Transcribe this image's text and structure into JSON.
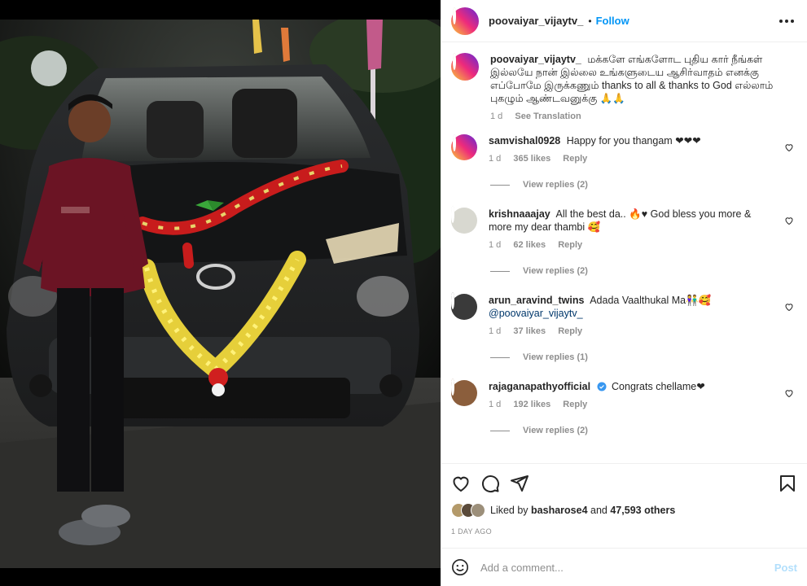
{
  "post": {
    "username": "poovaiyar_vijaytv_",
    "separator": "•",
    "follow_label": "Follow",
    "more_icon": "more-options-icon"
  },
  "caption": {
    "username": "poovaiyar_vijaytv_",
    "text": "மக்களே எங்களோட புதிய கார் நீங்கள் இல்லயே நான் இல்லை உங்களுடைய ஆசிர்வாதம் எனக்கு எப்போமே இருக்கணும் thanks to all & thanks to God எல்லாம் புகழும் ஆண்டவனுக்கு 🙏🙏",
    "time": "1 d",
    "translation_label": "See Translation"
  },
  "comments": [
    {
      "username": "samvishal0928",
      "text": "Happy for you thangam ❤❤❤",
      "time": "1 d",
      "likes": "365 likes",
      "reply_label": "Reply",
      "view_replies": "View replies (2)",
      "avatar_color": "#c9a9d6"
    },
    {
      "username": "krishnaaajay",
      "text": "All the best da.. 🔥♥ God bless you more & more my dear thambi 🥰",
      "time": "1 d",
      "likes": "62 likes",
      "reply_label": "Reply",
      "view_replies": "View replies (2)",
      "avatar_color": "#d8d8d0"
    },
    {
      "username": "arun_aravind_twins",
      "text": "Adada Vaalthukal Ma👫🥰",
      "mention": "@poovaiyar_vijaytv_",
      "time": "1 d",
      "likes": "37 likes",
      "reply_label": "Reply",
      "view_replies": "View replies (1)",
      "avatar_color": "#3a3a3a"
    },
    {
      "username": "rajaganapathyofficial",
      "text": "Congrats chellame❤",
      "time": "1 d",
      "likes": "192 likes",
      "reply_label": "Reply",
      "view_replies": "View replies (2)",
      "avatar_color": "#8b5e3c"
    }
  ],
  "actions": {
    "like_icon": "heart-icon",
    "comment_icon": "comment-icon",
    "share_icon": "share-icon",
    "save_icon": "bookmark-icon"
  },
  "likes": {
    "prefix": "Liked by",
    "user": "basharose4",
    "and": "and",
    "count": "47,593 others"
  },
  "time_ago": "1 DAY AGO",
  "comment_box": {
    "placeholder": "Add a comment...",
    "post_label": "Post",
    "emoji_icon": "emoji-icon"
  },
  "colors": {
    "accent": "#0095f6",
    "text": "#262626",
    "muted": "#8e8e8e",
    "heart": "#ed4956",
    "post_disabled": "#b2dffc"
  }
}
